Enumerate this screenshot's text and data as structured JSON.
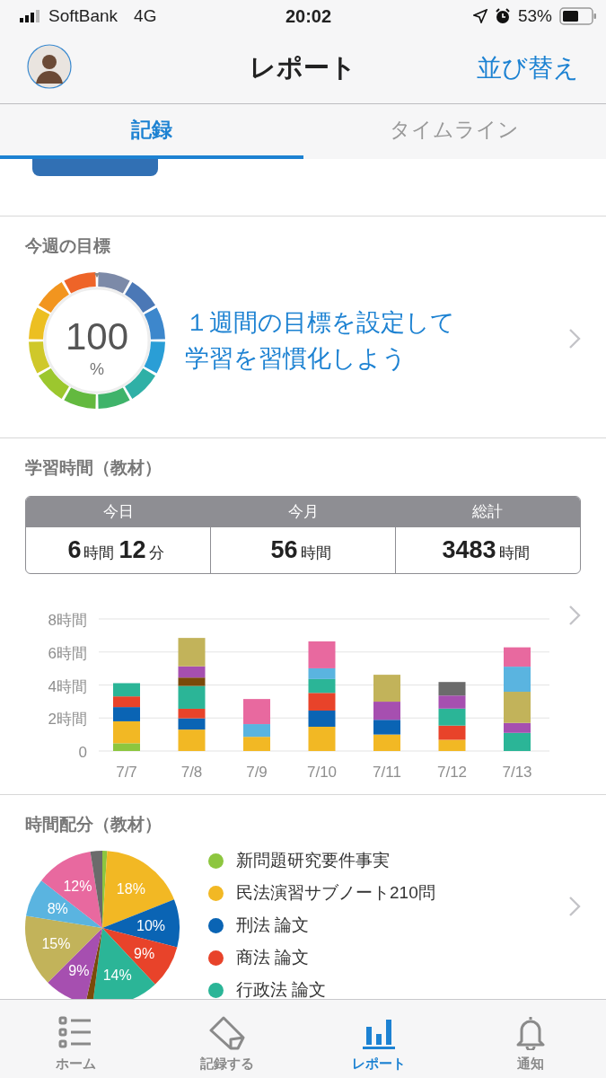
{
  "status_bar": {
    "carrier": "SoftBank",
    "network": "4G",
    "time": "20:02",
    "battery": "53%"
  },
  "nav": {
    "title": "レポート",
    "action": "並び替え"
  },
  "tabs": [
    {
      "label": "記録",
      "selected": true
    },
    {
      "label": "タイムライン",
      "selected": false
    }
  ],
  "goal": {
    "heading": "今週の目標",
    "value": "100",
    "unit": "%",
    "message_lines": [
      "１週間の目標を設定して",
      "学習を習慣化しよう"
    ]
  },
  "study_time": {
    "heading": "学習時間（教材）",
    "stats": [
      {
        "label": "今日",
        "parts": [
          {
            "value": "6",
            "unit": "時間"
          },
          {
            "value": "12",
            "unit": "分"
          }
        ]
      },
      {
        "label": "今月",
        "parts": [
          {
            "value": "56",
            "unit": "時間"
          }
        ]
      },
      {
        "label": "総計",
        "parts": [
          {
            "value": "3483",
            "unit": "時間"
          }
        ]
      }
    ],
    "chart_data": {
      "type": "bar",
      "stacked": true,
      "grid": true,
      "categories": [
        "7/7",
        "7/8",
        "7/9",
        "7/10",
        "7/11",
        "7/12",
        "7/13"
      ],
      "ylim": [
        0,
        8
      ],
      "yticks": [
        {
          "value": 0,
          "label": "0"
        },
        {
          "value": 2,
          "label": "2時間"
        },
        {
          "value": 4,
          "label": "4時間"
        },
        {
          "value": 6,
          "label": "6時間"
        },
        {
          "value": 8,
          "label": "8時間"
        }
      ],
      "series": [
        {
          "color": "#8dc63f",
          "values": [
            0.47,
            null,
            null,
            null,
            null,
            null,
            null
          ]
        },
        {
          "color": "#f2b824",
          "values": [
            1.33,
            1.3,
            0.86,
            1.47,
            1.0,
            0.68,
            null
          ]
        },
        {
          "color": "#0a64b4",
          "values": [
            0.86,
            0.68,
            null,
            0.98,
            0.89,
            null,
            null
          ]
        },
        {
          "color": "#e8432a",
          "values": [
            0.65,
            0.58,
            null,
            1.07,
            null,
            0.86,
            null
          ]
        },
        {
          "color": "#2bb597",
          "values": [
            0.8,
            1.38,
            null,
            0.84,
            null,
            1.03,
            1.1
          ]
        },
        {
          "color": "#7a4a0a",
          "values": [
            null,
            0.51,
            null,
            null,
            null,
            null,
            null
          ]
        },
        {
          "color": "#a64fb0",
          "values": [
            null,
            0.68,
            null,
            null,
            1.1,
            0.79,
            0.6
          ]
        },
        {
          "color": "#c2b35a",
          "values": [
            null,
            1.72,
            null,
            null,
            1.63,
            null,
            1.89
          ]
        },
        {
          "color": "#5ab4e0",
          "values": [
            null,
            null,
            0.77,
            0.65,
            null,
            null,
            1.52
          ]
        },
        {
          "color": "#e8699f",
          "values": [
            null,
            null,
            1.52,
            1.63,
            null,
            null,
            1.17
          ]
        },
        {
          "color": "#6b6b6b",
          "values": [
            null,
            null,
            null,
            null,
            null,
            0.82,
            null
          ]
        }
      ]
    }
  },
  "allocation": {
    "heading": "時間配分（教材）",
    "chart_data": {
      "type": "pie",
      "values": [
        1,
        18,
        10,
        9,
        14,
        1.5,
        9,
        15,
        8,
        12,
        2.5
      ],
      "colors": [
        "#8dc63f",
        "#f2b824",
        "#0a64b4",
        "#e8432a",
        "#2bb597",
        "#7a4a0a",
        "#a64fb0",
        "#c2b35a",
        "#5ab4e0",
        "#e8699f",
        "#6b6b6b"
      ],
      "value_labels": [
        null,
        "18%",
        "10%",
        "9%",
        "14%",
        null,
        "9%",
        "15%",
        "8%",
        "12%",
        null
      ]
    },
    "legend": [
      {
        "name": "新問題研究要件事実",
        "color": "#8dc63f"
      },
      {
        "name": "民法演習サブノート210問",
        "color": "#f2b824"
      },
      {
        "name": "刑法 論文",
        "color": "#0a64b4"
      },
      {
        "name": "商法 論文",
        "color": "#e8432a"
      },
      {
        "name": "行政法 論文",
        "color": "#2bb597"
      }
    ]
  },
  "tab_bar": [
    {
      "kind": "list",
      "label": "ホーム",
      "selected": false
    },
    {
      "kind": "tag",
      "label": "記録する",
      "selected": false
    },
    {
      "kind": "chart",
      "label": "レポート",
      "selected": true
    },
    {
      "kind": "bell",
      "label": "通知",
      "selected": false
    }
  ]
}
